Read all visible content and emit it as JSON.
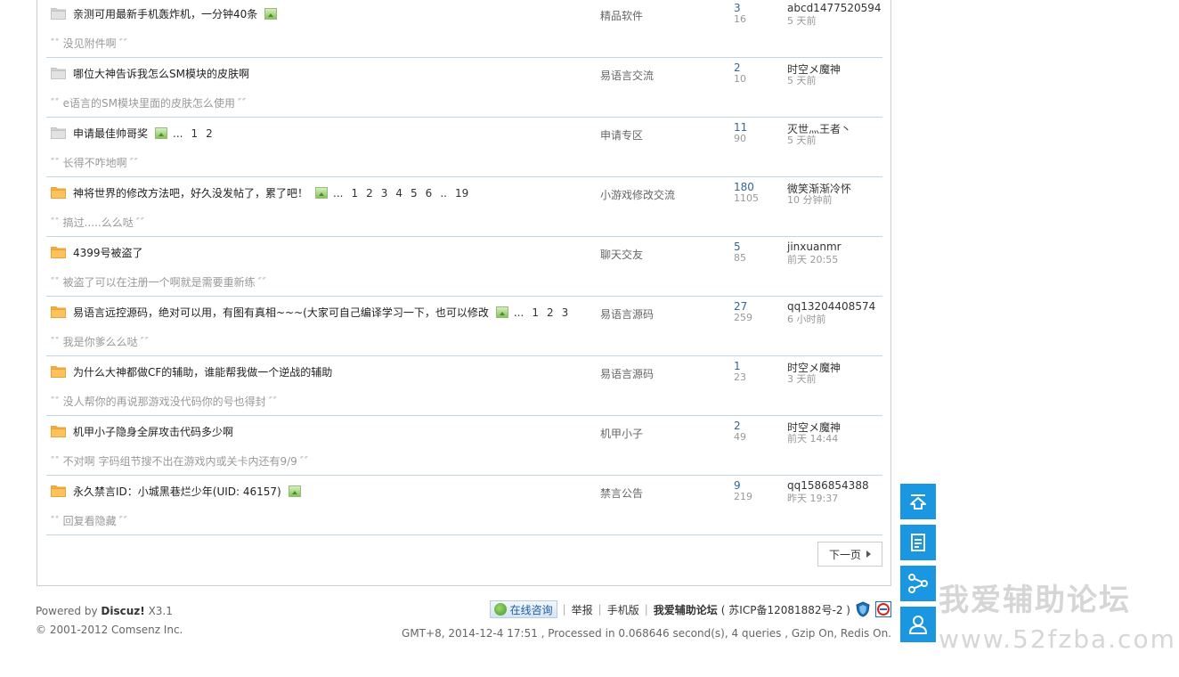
{
  "threads": [
    {
      "icon": "gray",
      "title": "亲测可用最新手机轰炸机，一分钟40条",
      "has_image": true,
      "pages": [],
      "forum": "精品软件",
      "replies": "3",
      "views": "16",
      "last_user": "abcd1477520594",
      "last_time": "5 天前",
      "quote": "没见附件啊"
    },
    {
      "icon": "gray",
      "title": "哪位大神告诉我怎么SM模块的皮肤啊",
      "has_image": false,
      "pages": [],
      "forum": "易语言交流",
      "replies": "2",
      "views": "10",
      "last_user": "时空メ魔神",
      "last_time": "5 天前",
      "quote": "e语言的SM模块里面的皮肤怎么使用"
    },
    {
      "icon": "gray",
      "title": "申请最佳帅哥奖",
      "has_image": true,
      "pages": [
        "...",
        "1",
        "2"
      ],
      "forum": "申请专区",
      "replies": "11",
      "views": "90",
      "last_user": "灭世灬王者丶",
      "last_time": "5 天前",
      "quote": "长得不咋地啊"
    },
    {
      "icon": "orange",
      "title": "神将世界的修改方法吧，好久没发帖了，累了吧！",
      "has_image": true,
      "pages": [
        "...",
        "1",
        "2",
        "3",
        "4",
        "5",
        "6",
        "..",
        "19"
      ],
      "forum": "小游戏修改交流",
      "replies": "180",
      "views": "1105",
      "last_user": "微笑渐渐冷怀",
      "last_time": "10 分钟前",
      "quote": "搞过.....么么哒"
    },
    {
      "icon": "orange",
      "title": "4399号被盗了",
      "has_image": false,
      "pages": [],
      "forum": "聊天交友",
      "replies": "5",
      "views": "85",
      "last_user": "jinxuanmr",
      "last_time": "前天 20:55",
      "quote": "被盗了可以在注册一个啊就是需要重新练"
    },
    {
      "icon": "orange",
      "title": "易语言远控源码，绝对可以用，有图有真相~~~(大家可自己编译学习一下，也可以修改",
      "has_image": true,
      "pages": [
        "...",
        "1",
        "2",
        "3"
      ],
      "forum": "易语言源码",
      "replies": "27",
      "views": "259",
      "last_user": "qq13204408574",
      "last_time": "6 小时前",
      "quote": "我是你爹么么哒"
    },
    {
      "icon": "orange",
      "title": "为什么大神都做CF的辅助，谁能帮我做一个逆战的辅助",
      "has_image": false,
      "pages": [],
      "forum": "易语言源码",
      "replies": "1",
      "views": "23",
      "last_user": "时空メ魔神",
      "last_time": "3 天前",
      "quote": "没人帮你的再说那游戏没代码你的号也得封"
    },
    {
      "icon": "orange",
      "title": "机甲小子隐身全屏攻击代码多少啊",
      "has_image": false,
      "pages": [],
      "forum": "机甲小子",
      "replies": "2",
      "views": "49",
      "last_user": "时空メ魔神",
      "last_time": "前天 14:44",
      "quote": "不对啊 字码组节搜不出在游戏内或关卡内还有9/9"
    },
    {
      "icon": "orange",
      "title": "永久禁言ID：小城黑巷烂少年(UID: 46157)",
      "has_image": true,
      "pages": [],
      "forum": "禁言公告",
      "replies": "9",
      "views": "219",
      "last_user": "qq1586854388",
      "last_time": "昨天 19:37",
      "quote": "回复看隐藏"
    }
  ],
  "pagination": {
    "next_label": "下一页"
  },
  "footer": {
    "powered_prefix": "Powered by",
    "powered_brand": "Discuz!",
    "powered_version": "X3.1",
    "copyright": "© 2001-2012 Comsenz Inc.",
    "consult_label": "在线咨询",
    "report_label": "举报",
    "mobile_label": "手机版",
    "site_name": "我爱辅助论坛",
    "icp": "( 苏ICP备12081882号-2 )",
    "stats": "GMT+8, 2014-12-4 17:51 , Processed in 0.068646 second(s), 4 queries , Gzip On, Redis On."
  },
  "side_buttons": [
    {
      "name": "back-to-top-button",
      "icon": "arrow-up-icon"
    },
    {
      "name": "new-post-button",
      "icon": "document-icon"
    },
    {
      "name": "share-button",
      "icon": "share-icon"
    },
    {
      "name": "user-button",
      "icon": "user-icon"
    }
  ],
  "watermark": {
    "line1": "我爱辅助论坛",
    "line2": "www.52fzba.com"
  },
  "colors": {
    "accent": "#1a97e0",
    "link": "#336699",
    "divider": "#c2d5e3"
  }
}
